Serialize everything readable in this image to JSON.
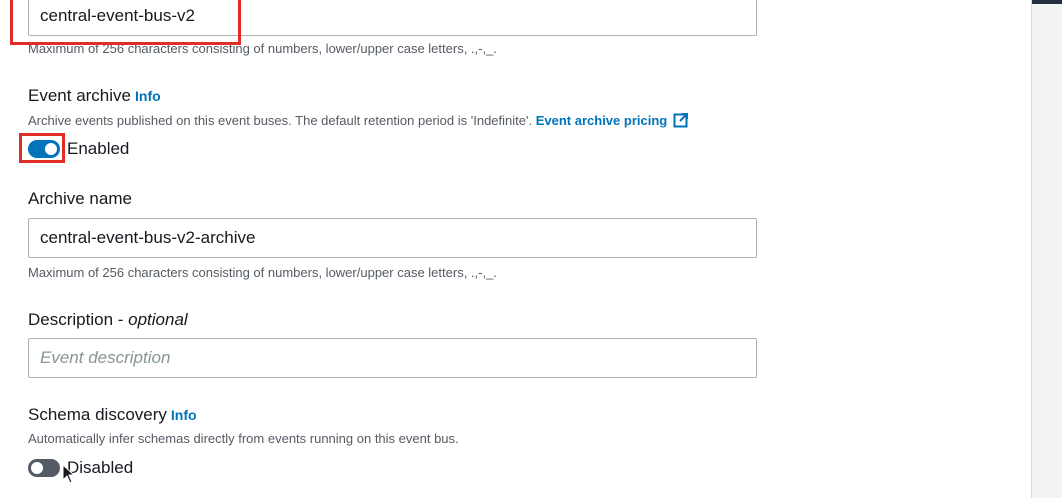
{
  "event_bus": {
    "name_value": "central-event-bus-v2",
    "name_hint": "Maximum of 256 characters consisting of numbers, lower/upper case letters, .,-,_."
  },
  "event_archive": {
    "label": "Event archive",
    "info": "Info",
    "description": "Archive events published on this event buses. The default retention period is 'Indefinite'.",
    "pricing_link": "Event archive pricing",
    "toggle_label": "Enabled"
  },
  "archive_name": {
    "label": "Archive name",
    "value": "central-event-bus-v2-archive",
    "hint": "Maximum of 256 characters consisting of numbers, lower/upper case letters, .,-,_."
  },
  "description": {
    "label": "Description - ",
    "optional": "optional",
    "placeholder": "Event description"
  },
  "schema_discovery": {
    "label": "Schema discovery",
    "info": "Info",
    "description": "Automatically infer schemas directly from events running on this event bus.",
    "toggle_label": "Disabled"
  },
  "colors": {
    "accent": "#0073bb",
    "highlight": "#e02d28"
  },
  "icons": {
    "external_link": "external-link-icon",
    "cursor": "mouse-cursor-icon"
  }
}
